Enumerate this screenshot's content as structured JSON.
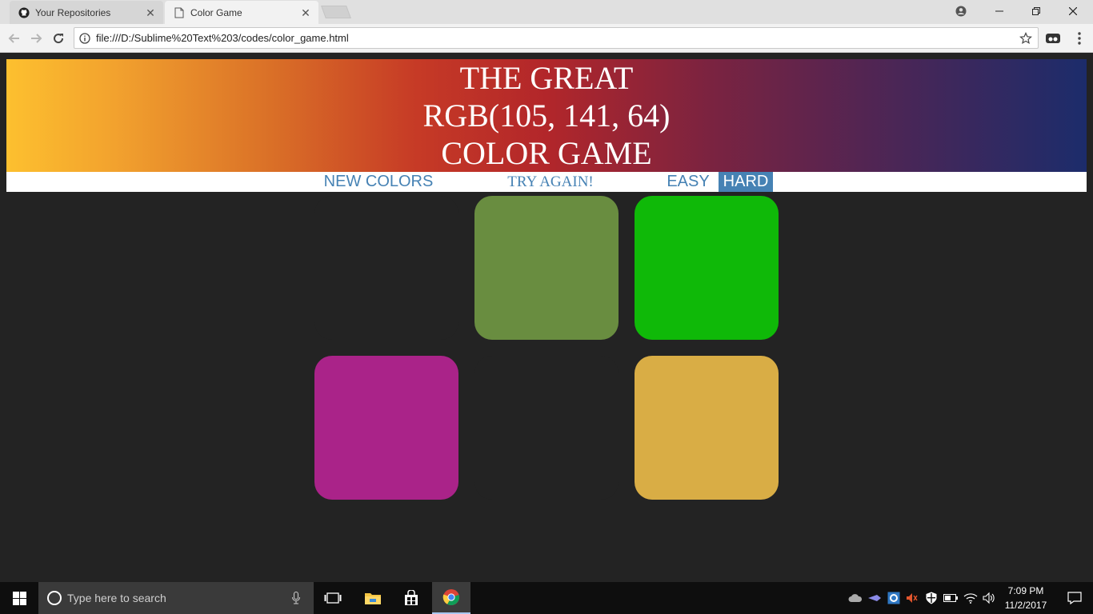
{
  "browser": {
    "tabs": [
      {
        "title": "Your Repositories",
        "icon": "github-icon",
        "active": false
      },
      {
        "title": "Color Game",
        "icon": "page-icon",
        "active": true
      }
    ],
    "address_bar": {
      "url": "file:///D:/Sublime%20Text%203/codes/color_game.html"
    }
  },
  "game": {
    "header": {
      "line1": "THE GREAT",
      "rgb_display": "RGB(105, 141, 64)",
      "line3": "COLOR GAME"
    },
    "stripe": {
      "new_colors_label": "NEW COLORS",
      "message": "TRY AGAIN!",
      "easy_label": "EASY",
      "hard_label": "HARD",
      "selected_mode": "HARD"
    },
    "squares": [
      {
        "color": "#232323",
        "visible": false
      },
      {
        "color": "#698d40",
        "visible": true
      },
      {
        "color": "#0fb908",
        "visible": true
      },
      {
        "color": "#aa2389",
        "visible": true
      },
      {
        "color": "#232323",
        "visible": false
      },
      {
        "color": "#d9ad45",
        "visible": true
      }
    ],
    "colors": {
      "background": "#232323",
      "accent": "#4682b4"
    }
  },
  "taskbar": {
    "search_placeholder": "Type here to search",
    "clock": {
      "time": "7:09 PM",
      "date": "11/2/2017"
    }
  }
}
